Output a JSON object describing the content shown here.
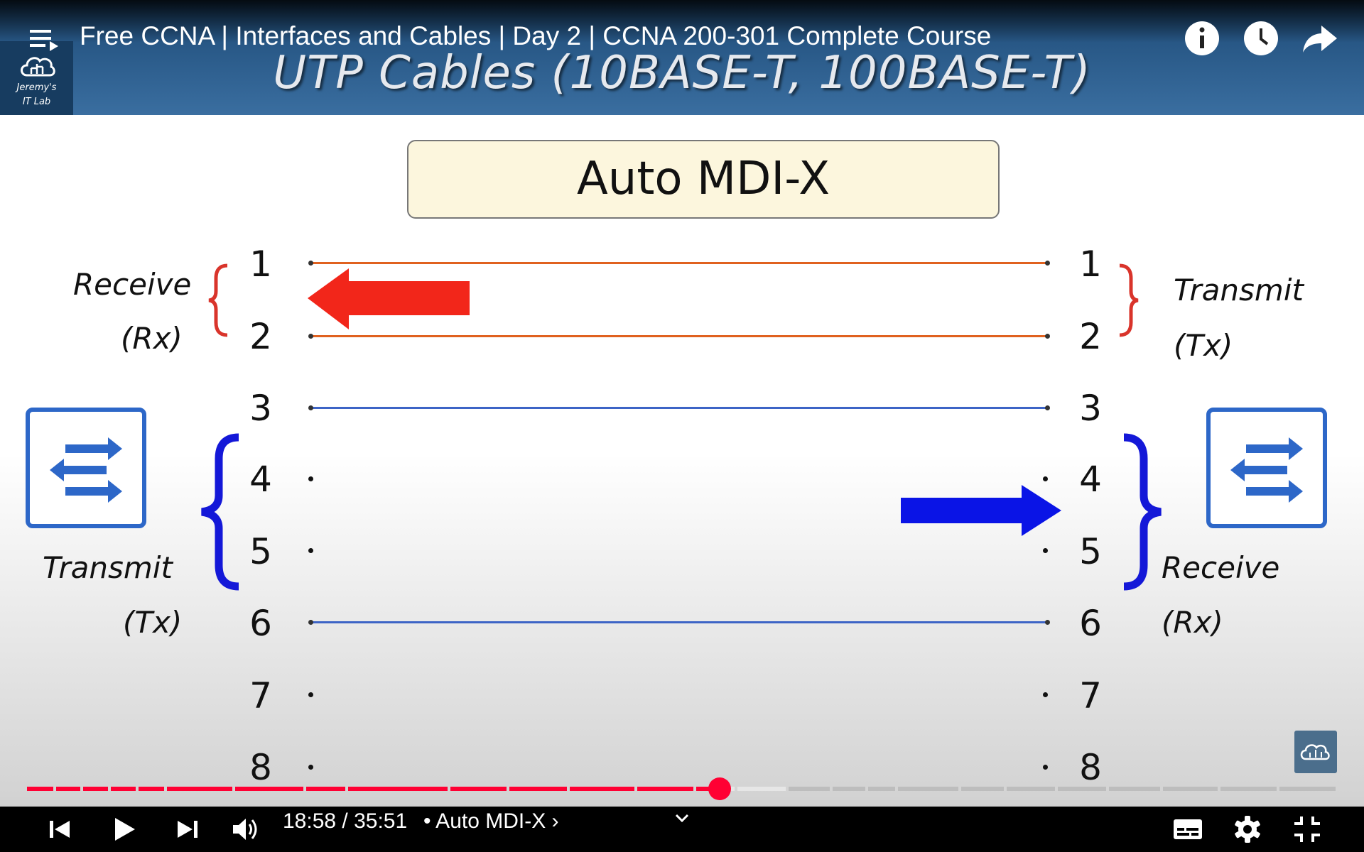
{
  "overlay": {
    "video_title": "Free CCNA | Interfaces and Cables | Day 2 | CCNA 200-301 Complete Course",
    "top_icons": [
      "menu-playlist-icon",
      "info-icon",
      "watch-later-clock-icon",
      "share-arrow-icon"
    ]
  },
  "slide": {
    "title": "UTP Cables (10BASE-T, 100BASE-T)",
    "logo_line1": "Jeremy's",
    "logo_line2": "IT Lab",
    "box_title": "Auto MDI-X",
    "pins_left": [
      "1",
      "2",
      "3",
      "4",
      "5",
      "6",
      "7",
      "8"
    ],
    "pins_right": [
      "1",
      "2",
      "3",
      "4",
      "5",
      "6",
      "7",
      "8"
    ],
    "left_top_label": "Receive",
    "left_top_sub": "(Rx)",
    "left_bottom_label": "Transmit",
    "left_bottom_sub": "(Tx)",
    "right_top_label": "Transmit",
    "right_top_sub": "(Tx)",
    "right_bottom_label": "Receive",
    "right_bottom_sub": "(Rx)",
    "colors": {
      "orange_wire": "#e0611f",
      "blue_wire": "#3d64c6",
      "red_arrow": "#f2261a",
      "blue_arrow": "#0a14e6",
      "header": "#2b5c8c"
    }
  },
  "player": {
    "time_current": "18:58",
    "time_separator": " / ",
    "time_total": "35:51",
    "chapter": "• Auto MDI-X ›",
    "progress_fraction": 0.529,
    "accent": "#ff0033",
    "controls": [
      "previous-icon",
      "play-icon",
      "next-icon",
      "volume-icon",
      "chevron-down-icon",
      "subtitles-icon",
      "settings-gear-icon",
      "exit-fullscreen-icon"
    ]
  }
}
